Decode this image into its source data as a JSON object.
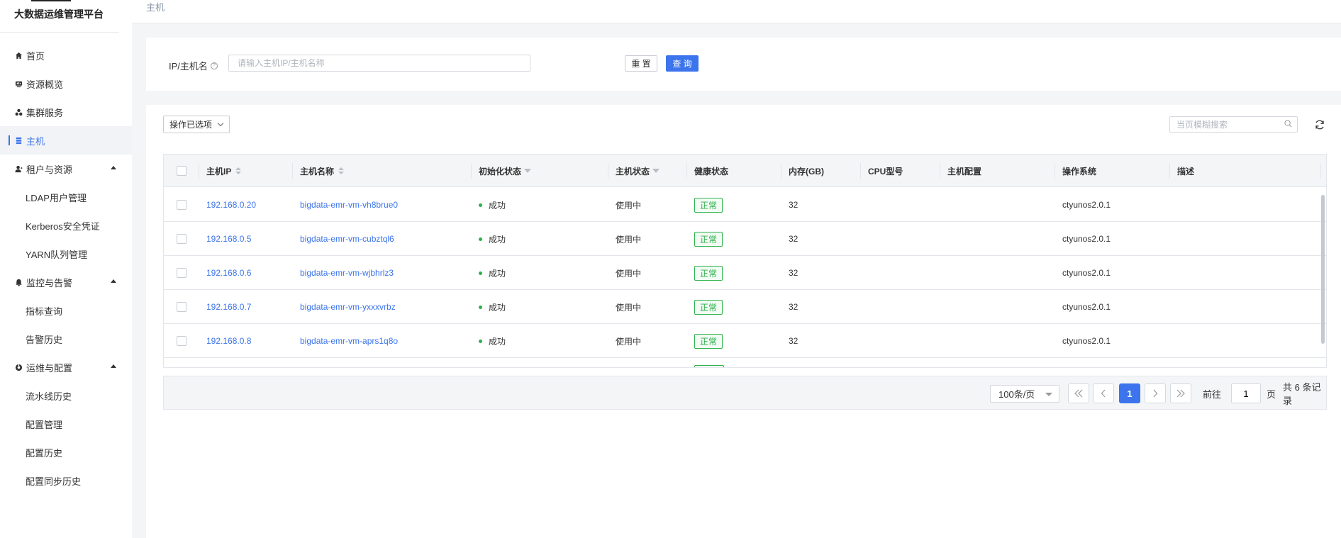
{
  "app": {
    "title": "大数据运维管理平台"
  },
  "colors": {
    "accent": "#3b74ec",
    "success": "#2cb14a",
    "link": "#3b74ec"
  },
  "sidebar": {
    "items": [
      {
        "label": "首页",
        "icon": "home-icon"
      },
      {
        "label": "资源概览",
        "icon": "monitor-icon"
      },
      {
        "label": "集群服务",
        "icon": "cluster-icon"
      },
      {
        "label": "主机",
        "icon": "server-icon",
        "active": true
      },
      {
        "label": "租户与资源",
        "icon": "user-icon",
        "expanded": true,
        "children": [
          "LDAP用户管理",
          "Kerberos安全凭证",
          "YARN队列管理"
        ]
      },
      {
        "label": "监控与告警",
        "icon": "bell-icon",
        "expanded": true,
        "children": [
          "指标查询",
          "告警历史"
        ]
      },
      {
        "label": "运维与配置",
        "icon": "ops-icon",
        "expanded": true,
        "children": [
          "流水线历史",
          "配置管理",
          "配置历史",
          "配置同步历史"
        ]
      }
    ]
  },
  "breadcrumb": "主机",
  "search": {
    "label": "IP/主机名",
    "placeholder": "请输入主机IP/主机名称",
    "value": "",
    "reset_label": "重 置",
    "query_label": "查 询"
  },
  "toolbar": {
    "ops_label": "操作已选项",
    "page_search_placeholder": "当页模糊搜索"
  },
  "table": {
    "columns": [
      "主机IP",
      "主机名称",
      "初始化状态",
      "主机状态",
      "健康状态",
      "内存(GB)",
      "CPU型号",
      "主机配置",
      "操作系统",
      "描述"
    ],
    "rows": [
      {
        "ip": "192.168.0.20",
        "hostname": "bigdata-emr-vm-vh8brue0",
        "init": "成功",
        "status": "使用中",
        "health": "正常",
        "memory": "32",
        "cpu": "",
        "config": "",
        "os": "ctyunos2.0.1",
        "desc": ""
      },
      {
        "ip": "192.168.0.5",
        "hostname": "bigdata-emr-vm-cubztql6",
        "init": "成功",
        "status": "使用中",
        "health": "正常",
        "memory": "32",
        "cpu": "",
        "config": "",
        "os": "ctyunos2.0.1",
        "desc": ""
      },
      {
        "ip": "192.168.0.6",
        "hostname": "bigdata-emr-vm-wjbhrlz3",
        "init": "成功",
        "status": "使用中",
        "health": "正常",
        "memory": "32",
        "cpu": "",
        "config": "",
        "os": "ctyunos2.0.1",
        "desc": ""
      },
      {
        "ip": "192.168.0.7",
        "hostname": "bigdata-emr-vm-yxxxvrbz",
        "init": "成功",
        "status": "使用中",
        "health": "正常",
        "memory": "32",
        "cpu": "",
        "config": "",
        "os": "ctyunos2.0.1",
        "desc": ""
      },
      {
        "ip": "192.168.0.8",
        "hostname": "bigdata-emr-vm-aprs1q8o",
        "init": "成功",
        "status": "使用中",
        "health": "正常",
        "memory": "32",
        "cpu": "",
        "config": "",
        "os": "ctyunos2.0.1",
        "desc": ""
      }
    ]
  },
  "pagination": {
    "page_size": "100条/页",
    "current_page": "1",
    "goto_prefix": "前往",
    "goto_value": "1",
    "goto_suffix": "页",
    "total": "共 6 条记录"
  }
}
